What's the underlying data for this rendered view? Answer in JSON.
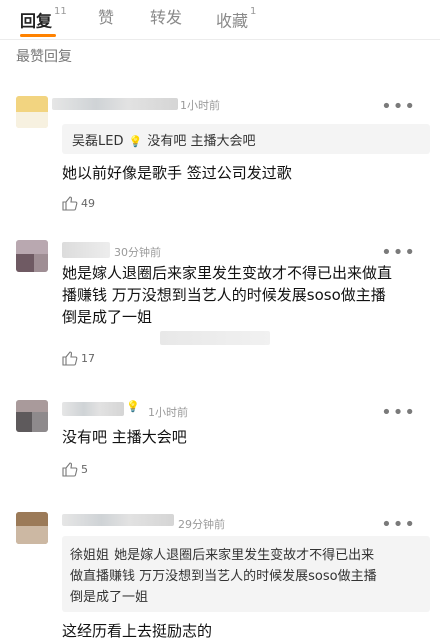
{
  "tabs": [
    {
      "label": "回复",
      "count": "11"
    },
    {
      "label": "赞",
      "count": ""
    },
    {
      "label": "转发",
      "count": ""
    },
    {
      "label": "收藏",
      "count": "1"
    }
  ],
  "section_title": "最赞回复",
  "comments": [
    {
      "time": "1小时前",
      "quote": {
        "author": "吴磊LED",
        "text": "没有吧 主播大会吧"
      },
      "text": "她以前好像是歌手 签过公司发过歌",
      "likes": "49"
    },
    {
      "time": "30分钟前",
      "text_lines": [
        "她是嫁人退圈后来家里发生变故才不得已出来做直",
        "播赚钱 万万没想到当艺人的时候发展soso做主播",
        "倒是成了一姐"
      ],
      "likes": "17"
    },
    {
      "time": "1小时前",
      "text": "没有吧 主播大会吧",
      "likes": "5"
    },
    {
      "time": "29分钟前",
      "quote": {
        "author": "徐姐姐",
        "lines": [
          "她是嫁人退圈后来家里发生变故才不得已出来",
          "做直播赚钱 万万没想到当艺人的时候发展soso做主播",
          "倒是成了一姐"
        ]
      },
      "text": "这经历看上去挺励志的"
    }
  ],
  "colors": {
    "accent": "#ff8200",
    "bulb": "#f5c300"
  },
  "icons": {
    "more": "more-dots-icon",
    "like": "thumbs-up-icon",
    "bulb": "lightbulb-icon"
  }
}
